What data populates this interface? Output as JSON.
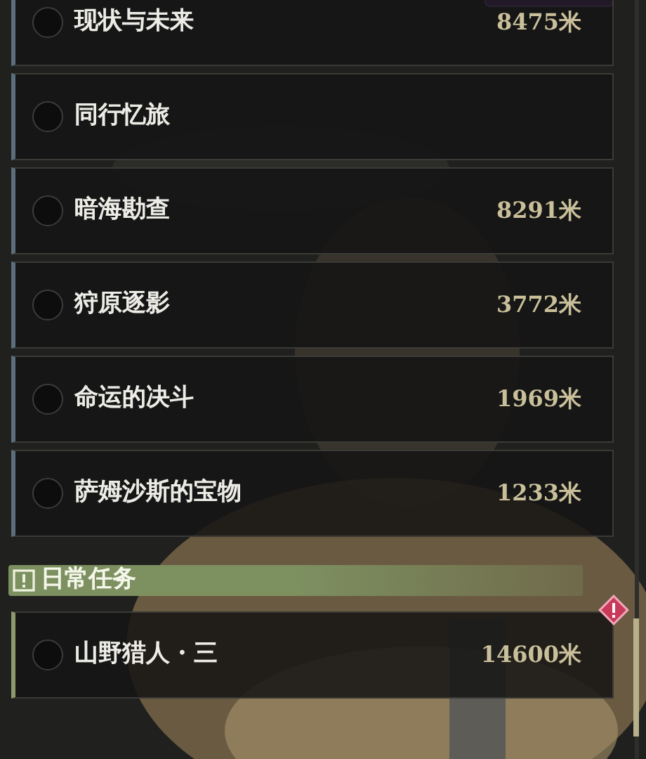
{
  "main_quests": [
    {
      "name": "现状与未来",
      "distance": "8475米"
    },
    {
      "name": "同行忆旅"
    },
    {
      "name": "暗海勘查",
      "distance": "8291米"
    },
    {
      "name": "狩原逐影",
      "distance": "3772米"
    },
    {
      "name": "命运的决斗",
      "distance": "1969米"
    },
    {
      "name": "萨姆沙斯的宝物",
      "distance": "1233米"
    }
  ],
  "daily_section": {
    "title": "日常任务",
    "quests": [
      {
        "name": "山野猎人・三",
        "distance": "14600米",
        "alert": true
      }
    ]
  }
}
